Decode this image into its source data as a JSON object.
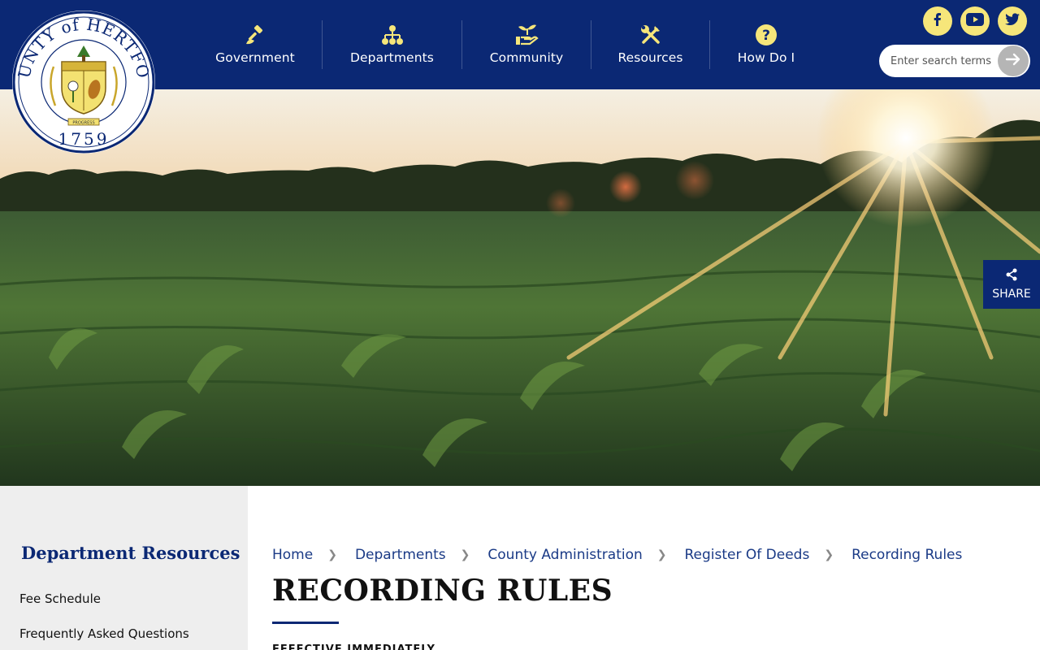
{
  "seal": {
    "top_text": "COUNTY of HERTFORD",
    "year": "1759",
    "motto": "PROGRESS"
  },
  "nav": [
    {
      "label": "Government",
      "icon": "gavel-icon"
    },
    {
      "label": "Departments",
      "icon": "org-chart-icon"
    },
    {
      "label": "Community",
      "icon": "hand-plant-icon"
    },
    {
      "label": "Resources",
      "icon": "tools-icon"
    },
    {
      "label": "How Do I",
      "icon": "question-icon"
    }
  ],
  "social": [
    {
      "name": "facebook",
      "glyph": "f"
    },
    {
      "name": "youtube",
      "glyph": "▶"
    },
    {
      "name": "twitter",
      "glyph": "t"
    }
  ],
  "search": {
    "placeholder": "Enter search terms"
  },
  "share": {
    "label": "SHARE"
  },
  "sidebar": {
    "heading": "Department Resources",
    "links": [
      "Fee Schedule",
      "Frequently Asked Questions"
    ]
  },
  "breadcrumb": [
    "Home",
    "Departments",
    "County Administration",
    "Register Of Deeds",
    "Recording Rules"
  ],
  "page": {
    "title": "RECORDING RULES",
    "intro": "EFFECTIVE IMMEDIATELY"
  },
  "colors": {
    "brand_navy": "#0b2874",
    "accent_yellow": "#f6e67a"
  }
}
